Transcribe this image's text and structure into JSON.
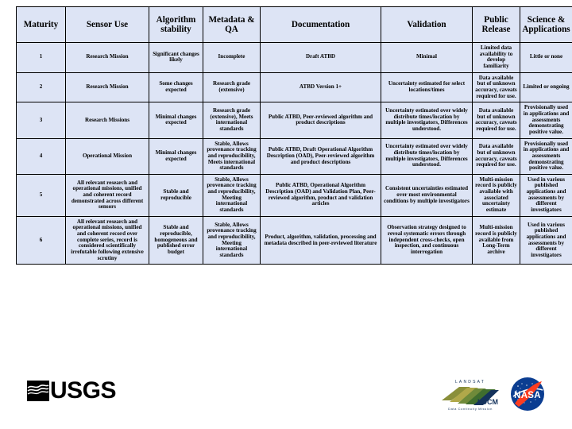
{
  "table": {
    "headers": [
      "Maturity",
      "Sensor Use",
      "Algorithm stability",
      "Metadata & QA",
      "Documentation",
      "Validation",
      "Public Release",
      "Science & Applications"
    ],
    "rows": [
      {
        "maturity": "1",
        "sensor_use": "Research Mission",
        "algorithm_stability": "Significant changes likely",
        "metadata_qa": "Incomplete",
        "documentation": "Draft ATBD",
        "validation": "Minimal",
        "public_release": "Limited data availability to develop familiarity",
        "science_applications": "Little or none"
      },
      {
        "maturity": "2",
        "sensor_use": "Research Mission",
        "algorithm_stability": "Some changes expected",
        "metadata_qa": "Research grade (extensive)",
        "documentation": "ATBD Version 1+",
        "validation": "Uncertainty estimated for select locations/times",
        "public_release": "Data available but of unknown accuracy, caveats required for use.",
        "science_applications": "Limited or ongoing"
      },
      {
        "maturity": "3",
        "sensor_use": "Research Missions",
        "algorithm_stability": "Minimal changes expected",
        "metadata_qa": "Research grade (extensive), Meets international standards",
        "documentation": "Public ATBD, Peer-reviewed algorithm and product descriptions",
        "validation": "Uncertainty estimated over widely distribute times/location by multiple investigators, Differences understood.",
        "public_release": "Data available but of unknown accuracy, caveats required for use.",
        "science_applications": "Provisionally used in applications and assessments demonstrating positive value."
      },
      {
        "maturity": "4",
        "sensor_use": "Operational Mission",
        "algorithm_stability": "Minimal changes expected",
        "metadata_qa": "Stable, Allows provenance tracking and reproducibility, Meets international standards",
        "documentation": "Public ATBD, Draft Operational Algorithm Description (OAD), Peer-reviewed algorithm and product descriptions",
        "validation": "Uncertainty estimated over widely distribute times/location by multiple investigators, Differences understood.",
        "public_release": "Data available but of unknown accuracy, caveats required for use.",
        "science_applications": "Provisionally used in applications and assessments demonstrating positive value."
      },
      {
        "maturity": "5",
        "sensor_use": "All relevant research and operational missions, unified and coherent record demonstrated across different sensors",
        "algorithm_stability": "Stable and reproducible",
        "metadata_qa": "Stable, Allows provenance tracking and reproducibility, Meeting international standards",
        "documentation": "Public ATBD, Operational Algorithm Description (OAD) and Validation Plan, Peer-reviewed algorithm, product and validation articles",
        "validation": "Consistent uncertainties estimated over most environmental conditions by multiple investigators",
        "public_release": "Multi-mission record is publicly available with associated uncertainty estimate",
        "science_applications": "Used in various published applications and assessments by different investigators"
      },
      {
        "maturity": "6",
        "sensor_use": "All relevant research and operational missions, unified and coherent record over complete series, record is considered scientifically irrefutable following extensive scrutiny",
        "algorithm_stability": "Stable and reproducible, homogeneous and published error budget",
        "metadata_qa": "Stable, Allows provenance tracking and reproducibility, Meeting international standards",
        "documentation": "Product, algorithm, validation, processing and metadata described in peer-reviewed literature",
        "validation": "Observation strategy designed to reveal systematic errors through independent cross-checks, open inspection, and continuous interrogation",
        "public_release": "Multi-mission record is publicly available from Long-Term archive",
        "science_applications": "Used in various published applications and assessments by different investigators"
      }
    ]
  },
  "footer": {
    "usgs": {
      "wordmark": "USGS",
      "icon": "usgs-wave-icon"
    },
    "landsat": {
      "top_text": "L A N D S A T",
      "acronym": "LDCM",
      "tagline": "Data Continuity Mission",
      "icon": "landsat-ldcm-icon"
    },
    "nasa": {
      "wordmark": "NASA",
      "icon": "nasa-meatball-icon"
    }
  },
  "colors": {
    "cell_fill": "#dde4f5",
    "border": "#000000",
    "text": "#000000",
    "nasa_blue": "#0b3d91",
    "nasa_red": "#fc3d21",
    "landsat_olive": "#8a8f3a",
    "landsat_green": "#3f6d2e",
    "landsat_navy": "#14325c"
  }
}
